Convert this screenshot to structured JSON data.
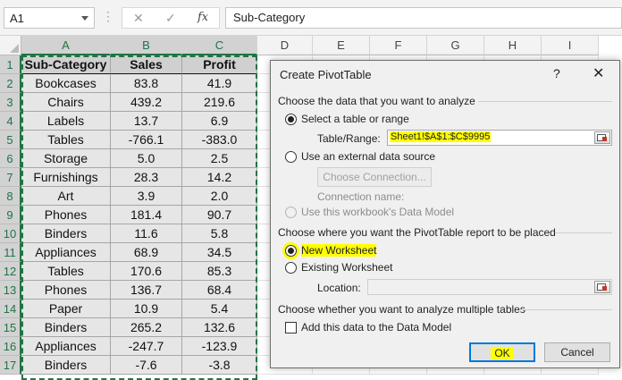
{
  "formula_bar": {
    "name_box": "A1",
    "cancel_glyph": "✕",
    "enter_glyph": "✓",
    "fx_label": "fx",
    "formula": "Sub-Category"
  },
  "columns": [
    "A",
    "B",
    "C",
    "D",
    "E",
    "F",
    "G",
    "H",
    "I"
  ],
  "rows": [
    "1",
    "2",
    "3",
    "4",
    "5",
    "6",
    "7",
    "8",
    "9",
    "10",
    "11",
    "12",
    "13",
    "14",
    "15",
    "16",
    "17"
  ],
  "table": {
    "headers": [
      "Sub-Category",
      "Sales",
      "Profit"
    ],
    "data": [
      [
        "Bookcases",
        "83.8",
        "41.9"
      ],
      [
        "Chairs",
        "439.2",
        "219.6"
      ],
      [
        "Labels",
        "13.7",
        "6.9"
      ],
      [
        "Tables",
        "-766.1",
        "-383.0"
      ],
      [
        "Storage",
        "5.0",
        "2.5"
      ],
      [
        "Furnishings",
        "28.3",
        "14.2"
      ],
      [
        "Art",
        "3.9",
        "2.0"
      ],
      [
        "Phones",
        "181.4",
        "90.7"
      ],
      [
        "Binders",
        "11.6",
        "5.8"
      ],
      [
        "Appliances",
        "68.9",
        "34.5"
      ],
      [
        "Tables",
        "170.6",
        "85.3"
      ],
      [
        "Phones",
        "136.7",
        "68.4"
      ],
      [
        "Paper",
        "10.9",
        "5.4"
      ],
      [
        "Binders",
        "265.2",
        "132.6"
      ],
      [
        "Appliances",
        "-247.7",
        "-123.9"
      ],
      [
        "Binders",
        "-7.6",
        "-3.8"
      ]
    ]
  },
  "dialog": {
    "title": "Create PivotTable",
    "help": "?",
    "close": "✕",
    "section1": "Choose the data that you want to analyze",
    "opt_select_table": "Select a table or range",
    "table_range_label": "Table/Range:",
    "table_range_value": "Sheet1!$A$1:$C$9995",
    "opt_external": "Use an external data source",
    "choose_connection": "Choose Connection...",
    "connection_name": "Connection name:",
    "opt_data_model": "Use this workbook's Data Model",
    "section2": "Choose where you want the PivotTable report to be placed",
    "opt_new_ws": "New Worksheet",
    "opt_existing_ws": "Existing Worksheet",
    "location_label": "Location:",
    "section3": "Choose whether you want to analyze multiple tables",
    "add_data_model": "Add this data to the Data Model",
    "ok": "OK",
    "cancel": "Cancel"
  }
}
